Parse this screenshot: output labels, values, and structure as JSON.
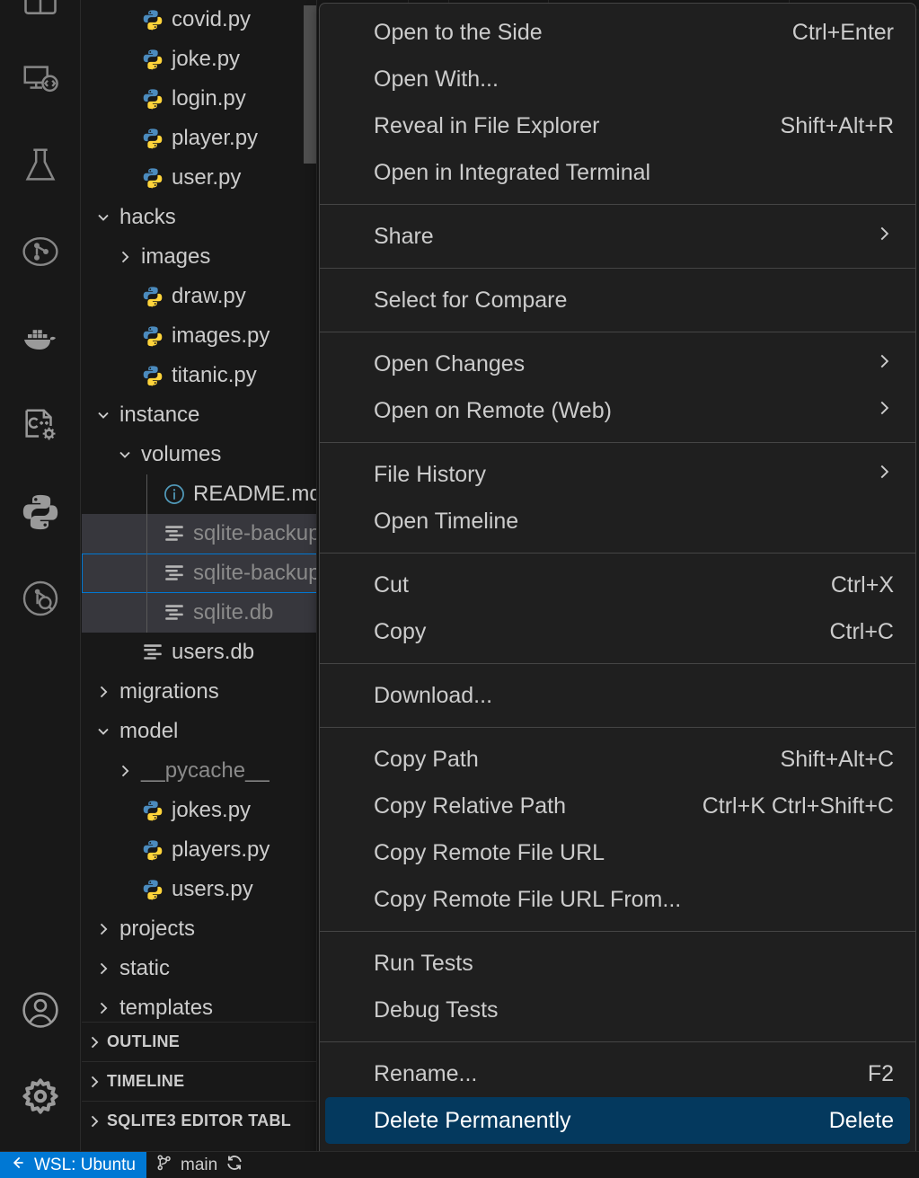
{
  "activity_bar": {
    "items": [
      {
        "name": "layout-panel-icon",
        "title": "Split Editor Layout"
      },
      {
        "name": "remote-explorer-icon",
        "title": "Remote Explorer"
      },
      {
        "name": "testing-flask-icon",
        "title": "Testing"
      },
      {
        "name": "source-control-graph-icon",
        "title": "Source Control Graph"
      },
      {
        "name": "docker-icon",
        "title": "Docker"
      },
      {
        "name": "cpp-settings-icon",
        "title": "C/C++ Configuration"
      },
      {
        "name": "python-icon",
        "title": "Python"
      },
      {
        "name": "sqlite-explorer-icon",
        "title": "SQLite Explorer"
      },
      {
        "name": "account-icon",
        "title": "Accounts"
      },
      {
        "name": "settings-gear-icon",
        "title": "Manage"
      }
    ]
  },
  "explorer": {
    "tree": [
      {
        "label": "covid.py",
        "indent": 2,
        "icon": "python",
        "state": "none",
        "selected": false,
        "dim": false
      },
      {
        "label": "joke.py",
        "indent": 2,
        "icon": "python",
        "state": "none",
        "selected": false,
        "dim": false
      },
      {
        "label": "login.py",
        "indent": 2,
        "icon": "python",
        "state": "none",
        "selected": false,
        "dim": false
      },
      {
        "label": "player.py",
        "indent": 2,
        "icon": "python",
        "state": "none",
        "selected": false,
        "dim": false
      },
      {
        "label": "user.py",
        "indent": 2,
        "icon": "python",
        "state": "none",
        "selected": false,
        "dim": false
      },
      {
        "label": "hacks",
        "indent": 1,
        "icon": "none",
        "state": "expanded",
        "selected": false,
        "dim": false
      },
      {
        "label": "images",
        "indent": 2,
        "icon": "none",
        "state": "collapsed",
        "selected": false,
        "dim": false
      },
      {
        "label": "draw.py",
        "indent": 2,
        "icon": "python",
        "state": "none",
        "selected": false,
        "dim": false
      },
      {
        "label": "images.py",
        "indent": 2,
        "icon": "python",
        "state": "none",
        "selected": false,
        "dim": false
      },
      {
        "label": "titanic.py",
        "indent": 2,
        "icon": "python",
        "state": "none",
        "selected": false,
        "dim": false
      },
      {
        "label": "instance",
        "indent": 1,
        "icon": "none",
        "state": "expanded",
        "selected": false,
        "dim": false
      },
      {
        "label": "volumes",
        "indent": 2,
        "icon": "none",
        "state": "expanded",
        "selected": false,
        "dim": false
      },
      {
        "label": "README.md",
        "indent": 3,
        "icon": "md",
        "state": "none",
        "selected": false,
        "dim": false
      },
      {
        "label": "sqlite-backup-",
        "indent": 3,
        "icon": "db",
        "state": "none",
        "selected": true,
        "dim": true
      },
      {
        "label": "sqlite-backup.",
        "indent": 3,
        "icon": "db",
        "state": "none",
        "selected": true,
        "dim": true,
        "focused": true
      },
      {
        "label": "sqlite.db",
        "indent": 3,
        "icon": "db",
        "state": "none",
        "selected": true,
        "dim": true
      },
      {
        "label": "users.db",
        "indent": 2,
        "icon": "db",
        "state": "none",
        "selected": false,
        "dim": false
      },
      {
        "label": "migrations",
        "indent": 1,
        "icon": "none",
        "state": "collapsed",
        "selected": false,
        "dim": false
      },
      {
        "label": "model",
        "indent": 1,
        "icon": "none",
        "state": "expanded",
        "selected": false,
        "dim": false
      },
      {
        "label": "__pycache__",
        "indent": 2,
        "icon": "none",
        "state": "collapsed",
        "selected": false,
        "dim": true
      },
      {
        "label": "jokes.py",
        "indent": 2,
        "icon": "python",
        "state": "none",
        "selected": false,
        "dim": false
      },
      {
        "label": "players.py",
        "indent": 2,
        "icon": "python",
        "state": "none",
        "selected": false,
        "dim": false
      },
      {
        "label": "users.py",
        "indent": 2,
        "icon": "python",
        "state": "none",
        "selected": false,
        "dim": false
      },
      {
        "label": "projects",
        "indent": 1,
        "icon": "none",
        "state": "collapsed",
        "selected": false,
        "dim": false
      },
      {
        "label": "static",
        "indent": 1,
        "icon": "none",
        "state": "collapsed",
        "selected": false,
        "dim": false
      },
      {
        "label": "templates",
        "indent": 1,
        "icon": "none",
        "state": "collapsed",
        "selected": false,
        "dim": false
      }
    ],
    "sections": [
      {
        "label": "OUTLINE",
        "state": "collapsed"
      },
      {
        "label": "TIMELINE",
        "state": "collapsed"
      },
      {
        "label": "SQLITE3 EDITOR TABL",
        "state": "collapsed"
      }
    ]
  },
  "context_menu": {
    "groups": [
      [
        {
          "label": "Open to the Side",
          "accel": "Ctrl+Enter",
          "submenu": false,
          "highlighted": false
        },
        {
          "label": "Open With...",
          "accel": "",
          "submenu": false,
          "highlighted": false
        },
        {
          "label": "Reveal in File Explorer",
          "accel": "Shift+Alt+R",
          "submenu": false,
          "highlighted": false
        },
        {
          "label": "Open in Integrated Terminal",
          "accel": "",
          "submenu": false,
          "highlighted": false
        }
      ],
      [
        {
          "label": "Share",
          "accel": "",
          "submenu": true,
          "highlighted": false
        }
      ],
      [
        {
          "label": "Select for Compare",
          "accel": "",
          "submenu": false,
          "highlighted": false
        }
      ],
      [
        {
          "label": "Open Changes",
          "accel": "",
          "submenu": true,
          "highlighted": false
        },
        {
          "label": "Open on Remote (Web)",
          "accel": "",
          "submenu": true,
          "highlighted": false
        }
      ],
      [
        {
          "label": "File History",
          "accel": "",
          "submenu": true,
          "highlighted": false
        },
        {
          "label": "Open Timeline",
          "accel": "",
          "submenu": false,
          "highlighted": false
        }
      ],
      [
        {
          "label": "Cut",
          "accel": "Ctrl+X",
          "submenu": false,
          "highlighted": false
        },
        {
          "label": "Copy",
          "accel": "Ctrl+C",
          "submenu": false,
          "highlighted": false
        }
      ],
      [
        {
          "label": "Download...",
          "accel": "",
          "submenu": false,
          "highlighted": false
        }
      ],
      [
        {
          "label": "Copy Path",
          "accel": "Shift+Alt+C",
          "submenu": false,
          "highlighted": false
        },
        {
          "label": "Copy Relative Path",
          "accel": "Ctrl+K Ctrl+Shift+C",
          "submenu": false,
          "highlighted": false
        },
        {
          "label": "Copy Remote File URL",
          "accel": "",
          "submenu": false,
          "highlighted": false
        },
        {
          "label": "Copy Remote File URL From...",
          "accel": "",
          "submenu": false,
          "highlighted": false
        }
      ],
      [
        {
          "label": "Run Tests",
          "accel": "",
          "submenu": false,
          "highlighted": false
        },
        {
          "label": "Debug Tests",
          "accel": "",
          "submenu": false,
          "highlighted": false
        }
      ],
      [
        {
          "label": "Rename...",
          "accel": "F2",
          "submenu": false,
          "highlighted": false
        },
        {
          "label": "Delete Permanently",
          "accel": "Delete",
          "submenu": false,
          "highlighted": true
        }
      ]
    ]
  },
  "status_bar": {
    "remote_label": "WSL: Ubuntu",
    "branch_label": "main"
  },
  "colors": {
    "accent_blue": "#0078d4",
    "menu_highlight": "#04395e",
    "selection_gray": "#37373d",
    "background": "#181818",
    "editor_background": "#1f1f1f",
    "python_blue": "#4b8bbe",
    "python_yellow": "#ffd43b",
    "md_blue": "#519aba"
  }
}
